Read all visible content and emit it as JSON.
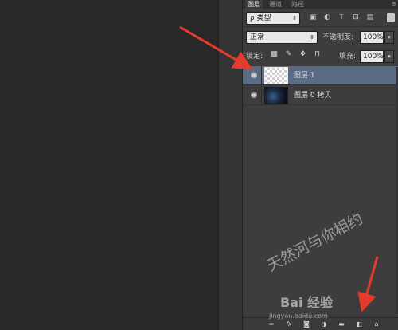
{
  "tabs": [
    {
      "label": "图层",
      "active": true
    },
    {
      "label": "通道",
      "active": false
    },
    {
      "label": "路径",
      "active": false
    }
  ],
  "filter": {
    "kind_label": "ρ 类型"
  },
  "blend": {
    "mode": "正常",
    "opacity_label": "不透明度:",
    "opacity_value": "100%"
  },
  "lock": {
    "label": "锁定:",
    "fill_label": "填充:",
    "fill_value": "100%"
  },
  "layers": [
    {
      "name": "图层 1",
      "selected": true,
      "thumb": "transparent"
    },
    {
      "name": "图层 0 拷贝",
      "selected": false,
      "thumb": "photo"
    }
  ],
  "watermark": {
    "text": "天然河与你相约",
    "brand": "Bai 经验",
    "url": "jingyan.baidu.com"
  },
  "colors": {
    "selected_layer": "#5a6c85",
    "annotation_arrow": "#e53a2c",
    "panel_bg": "#3d3d3d",
    "canvas_bg": "#282828"
  }
}
